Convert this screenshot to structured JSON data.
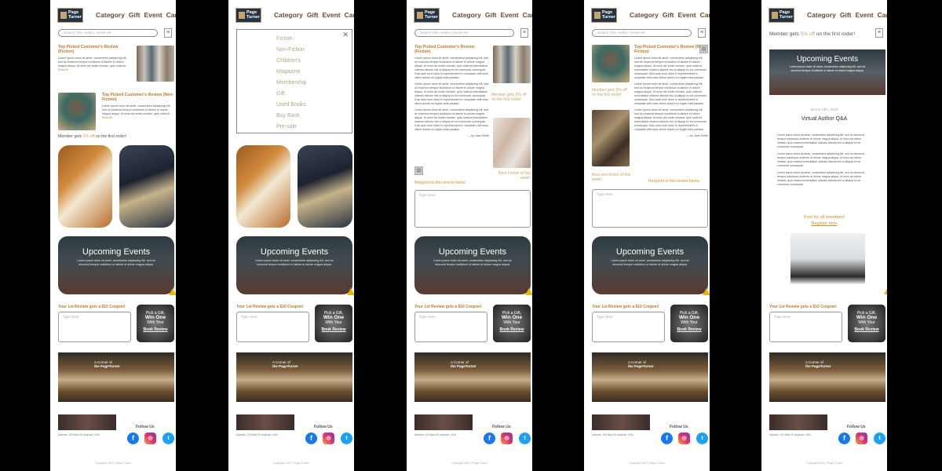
{
  "header": {
    "logo_text": "Page Turner",
    "nav": [
      "Category",
      "Gift",
      "Event",
      "Cart"
    ]
  },
  "search": {
    "placeholder": "Search Title, Author, Genre etc"
  },
  "menu_icon": "hamburger-icon",
  "reviews": {
    "fiction_title": "Top Picked Customer's Review (Fiction)",
    "nonfiction_title": "Top Picked Customer's Review (Non-Fiction)",
    "excerpt": "Lorem ipsum dolor sit amet, consectetur adipiscing elit, sed do eiusmod tempor incididunt ut labore et dolore magna aliqua. Ut enim ad minim veniam, quis nostrud...",
    "read_more": "Read M..."
  },
  "member": {
    "prefix": "Member gets",
    "highlight": "5% off",
    "suffix": "on the first order!"
  },
  "events": {
    "title": "Upcoming Events",
    "text": "Lorem ipsum dolor sit amet, consectetur adipiscing elit, sed do eiusmod tempor incididunt ut labore et dolore magna aliqua."
  },
  "first_review": {
    "headline": "Your 1st Review gets a $10 Coupon!",
    "placeholder": "Type Here",
    "promo_pick": "Pick a Gift,",
    "promo_win": "Win One",
    "promo_with": "With Your",
    "promo_link": "Book Review"
  },
  "corner": {
    "line1": "A Corner of",
    "line2": "the PageTurner"
  },
  "footer": {
    "address": "Address: 123 Main St, Anytown, USA",
    "follow": "Follow Us",
    "copyright": "Copyright 2022 | Page Turner"
  },
  "dropdown": {
    "items": [
      "Fiction",
      "Non-Fiction",
      "Children's",
      "Magazine",
      "Membership",
      "Gift",
      "Used Books",
      "Buy Back",
      "Pre-sale"
    ]
  },
  "review_detail": {
    "fiction_title": "Top Picked Customer's Review (Fiction)",
    "nonfiction_title": "Top Picked Customer's Review (Non-Fiction)",
    "body": "Lorem ipsum dolor sit amet, consectetur adipiscing elit, sed do eiusmod tempor incididunt ut labore et dolore magna aliqua. Ut enim ad minim veniam, quis nostrud exercitation ullamco laboris nisi ut aliquip ex ea commodo consequat. Duis aute irure dolor in reprehenderit in voluptate velit esse cillum dolore eu fugiat nulla pariatur.",
    "signature": "— by Jane Smith",
    "best_fiction": "Best Fiction of this week!",
    "best_nonfiction": "Best non-fiction of this week!",
    "respond": "Respond to this review below",
    "placeholder": "Type Here",
    "member_caption": "Member gets 5% off on the first order!"
  },
  "event_page": {
    "date": "March 16th, 2023",
    "title": "Virtual Author Q&A",
    "body": "Lorem ipsum dolor sit amet, consectetur adipiscing elit, sed do eiusmod tempor incididunt ut labore et dolore magna aliqua. Ut enim ad minim veniam, quis nostrud exercitation ullamco laboris nisi ut aliquip ex ea commodo consequat.",
    "free_line": "Free for all members!",
    "register": "Register here"
  },
  "social_icons": [
    "facebook-icon",
    "instagram-icon",
    "twitter-icon"
  ],
  "colors": {
    "accent": "#c07a2c",
    "gold": "#c8a46b",
    "navy": "#243447",
    "nav_text": "#6b4b2e"
  }
}
